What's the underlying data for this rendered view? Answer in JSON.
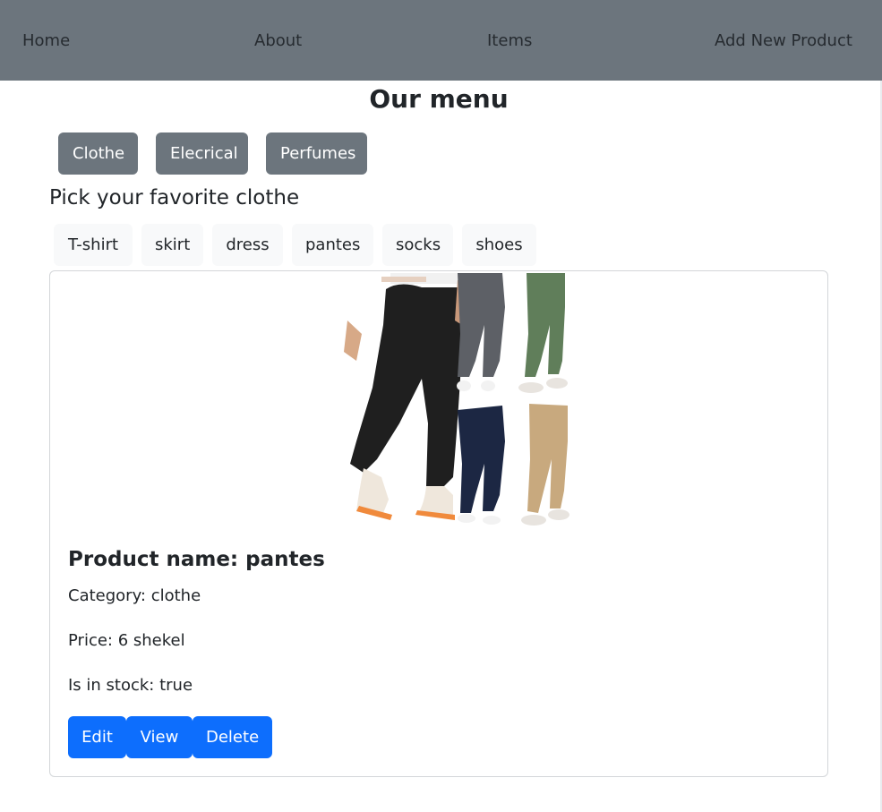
{
  "nav": {
    "home": "Home",
    "about": "About",
    "items": "Items",
    "add_new": "Add New Product"
  },
  "menu": {
    "title": "Our menu",
    "categories": [
      "Clothe",
      "Elecrical",
      "Perfumes"
    ]
  },
  "clothe": {
    "subtitle": "Pick your favorite clothe",
    "types": [
      "T-shirt",
      "skirt",
      "dress",
      "pantes",
      "socks",
      "shoes"
    ]
  },
  "product": {
    "name": "Product name: pantes",
    "category": "Category: clothe",
    "price": "Price: 6 shekel",
    "in_stock": "Is in stock: true",
    "image_alt": "pantes",
    "actions": {
      "edit": "Edit",
      "view": "View",
      "delete": "Delete"
    }
  },
  "colors": {
    "navbar": "#6c757d",
    "secondary_button": "#6c757d",
    "light_button": "#f8f9fa",
    "primary_button": "#0d6efd"
  }
}
